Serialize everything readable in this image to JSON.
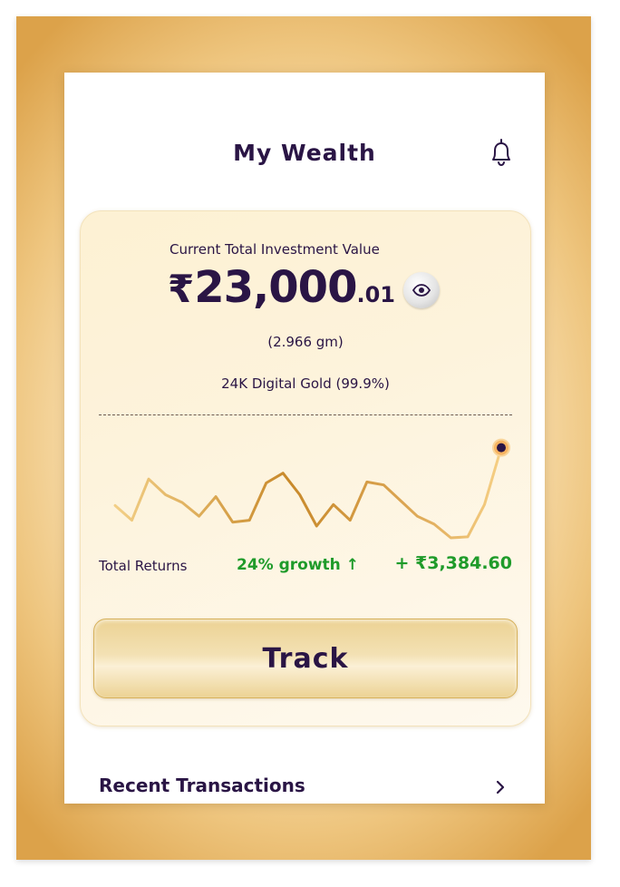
{
  "header": {
    "title": "My Wealth",
    "notification_icon": "bell-icon"
  },
  "investment": {
    "caption": "Current Total Investment Value",
    "currency_symbol": "₹",
    "amount_main": "23,000",
    "amount_decimal": ".01",
    "toggle_icon": "eye-icon",
    "grams": "(2.966 gm)",
    "purity": "24K Digital Gold (99.9%)"
  },
  "returns": {
    "label": "Total Returns",
    "growth": "24% growth ↑",
    "gain": "+ ₹3,384.60"
  },
  "track_button": {
    "label": "Track"
  },
  "recent": {
    "label": "Recent Transactions",
    "chevron_icon": "chevron-right-icon"
  },
  "colors": {
    "primary_text": "#2a1545",
    "positive": "#1f9b2a",
    "gold": "#d7a84e",
    "frame_gold": "#dca24a"
  },
  "sparkline": {
    "values": [
      0.33,
      0.18,
      0.6,
      0.44,
      0.36,
      0.22,
      0.42,
      0.16,
      0.18,
      0.56,
      0.66,
      0.44,
      0.12,
      0.34,
      0.18,
      0.57,
      0.54,
      0.38,
      0.22,
      0.14,
      0.0,
      0.01,
      0.34,
      0.92
    ]
  }
}
